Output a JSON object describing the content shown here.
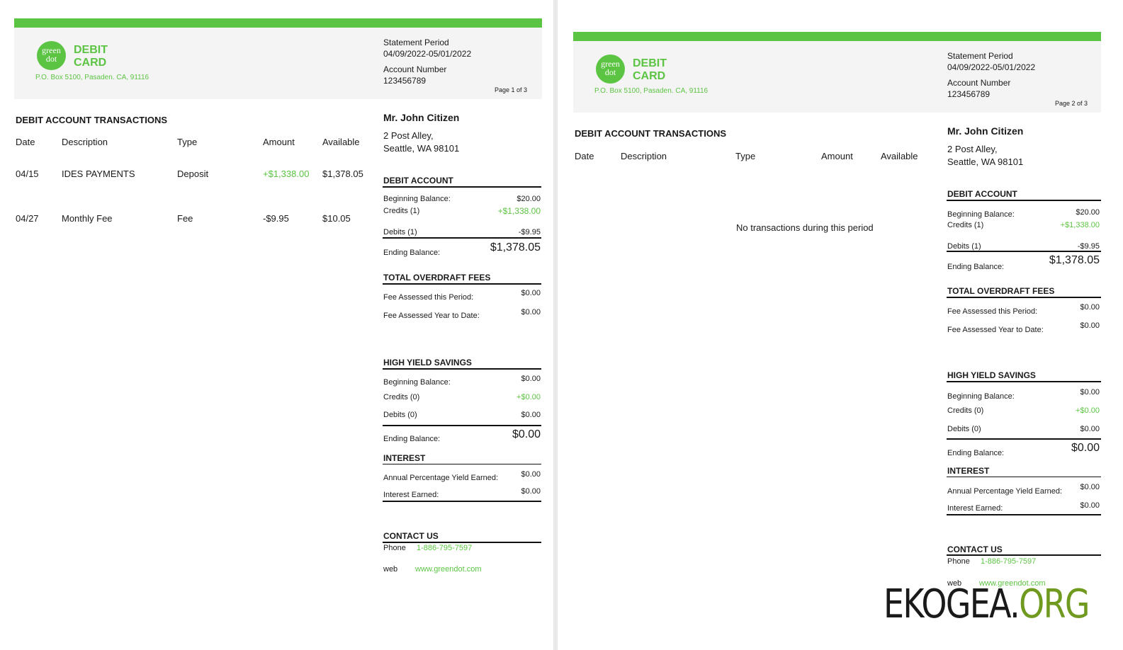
{
  "header": {
    "logo_line1": "green",
    "logo_line2": "dot",
    "brand_line1": "DEBIT",
    "brand_line2": "CARD",
    "address": "P.O. Box 5100, Pasaden. CA, 91116",
    "statement_period_label": "Statement Period",
    "statement_period_value": "04/09/2022-05/01/2022",
    "account_number_label": "Account Number",
    "account_number_value": "123456789"
  },
  "pages": [
    {
      "page_label": "Page 1 of 3"
    },
    {
      "page_label": "Page 2 of 3"
    }
  ],
  "transactions": {
    "title": "DEBIT ACCOUNT TRANSACTIONS",
    "columns": [
      "Date",
      "Description",
      "Type",
      "Amount",
      "Available"
    ],
    "rows": [
      {
        "date": "04/15",
        "description": "IDES PAYMENTS",
        "type": "Deposit",
        "amount": "+$1,338.00",
        "available": "$1,378.05"
      },
      {
        "date": "04/27",
        "description": "Monthly Fee",
        "type": "Fee",
        "amount": "-$9.95",
        "available": "$10.05"
      }
    ],
    "empty_message": "No transactions during this period"
  },
  "customer": {
    "name": "Mr. John Citizen",
    "street": "2 Post Alley,",
    "city": "Seattle, WA 98101"
  },
  "debit_account": {
    "title": "DEBIT ACCOUNT",
    "beginning_label": "Beginning Balance:",
    "beginning_value": "$20.00",
    "credits_label": "Credits (1)",
    "credits_value": "+$1,338.00",
    "debits_label": "Debits (1)",
    "debits_value": "-$9.95",
    "ending_label": "Ending Balance:",
    "ending_value": "$1,378.05"
  },
  "overdraft": {
    "title": "TOTAL OVERDRAFT FEES",
    "period_label": "Fee Assessed this Period:",
    "period_value": "$0.00",
    "ytd_label": "Fee Assessed Year to Date:",
    "ytd_value": "$0.00"
  },
  "savings": {
    "title": "HIGH YIELD SAVINGS",
    "beginning_label": "Beginning Balance:",
    "beginning_value": "$0.00",
    "credits_label": "Credits (0)",
    "credits_value": "+$0.00",
    "debits_label": "Debits (0)",
    "debits_value": "$0.00",
    "ending_label": "Ending Balance:",
    "ending_value": "$0.00"
  },
  "interest": {
    "title": "INTEREST",
    "apy_label": "Annual Percentage Yield Earned:",
    "apy_value": "$0.00",
    "earned_label": "Interest Earned:",
    "earned_value": "$0.00"
  },
  "contact": {
    "title": "CONTACT US",
    "phone_label": "Phone",
    "phone_value": "1-886-795-7597",
    "web_label": "web",
    "web_value": "www.greendot.com"
  },
  "watermark": {
    "part1": "EKOGEA.",
    "part2": "ORG"
  },
  "colors": {
    "brand_green": "#5cc443",
    "watermark_green": "#6f9a1f"
  }
}
